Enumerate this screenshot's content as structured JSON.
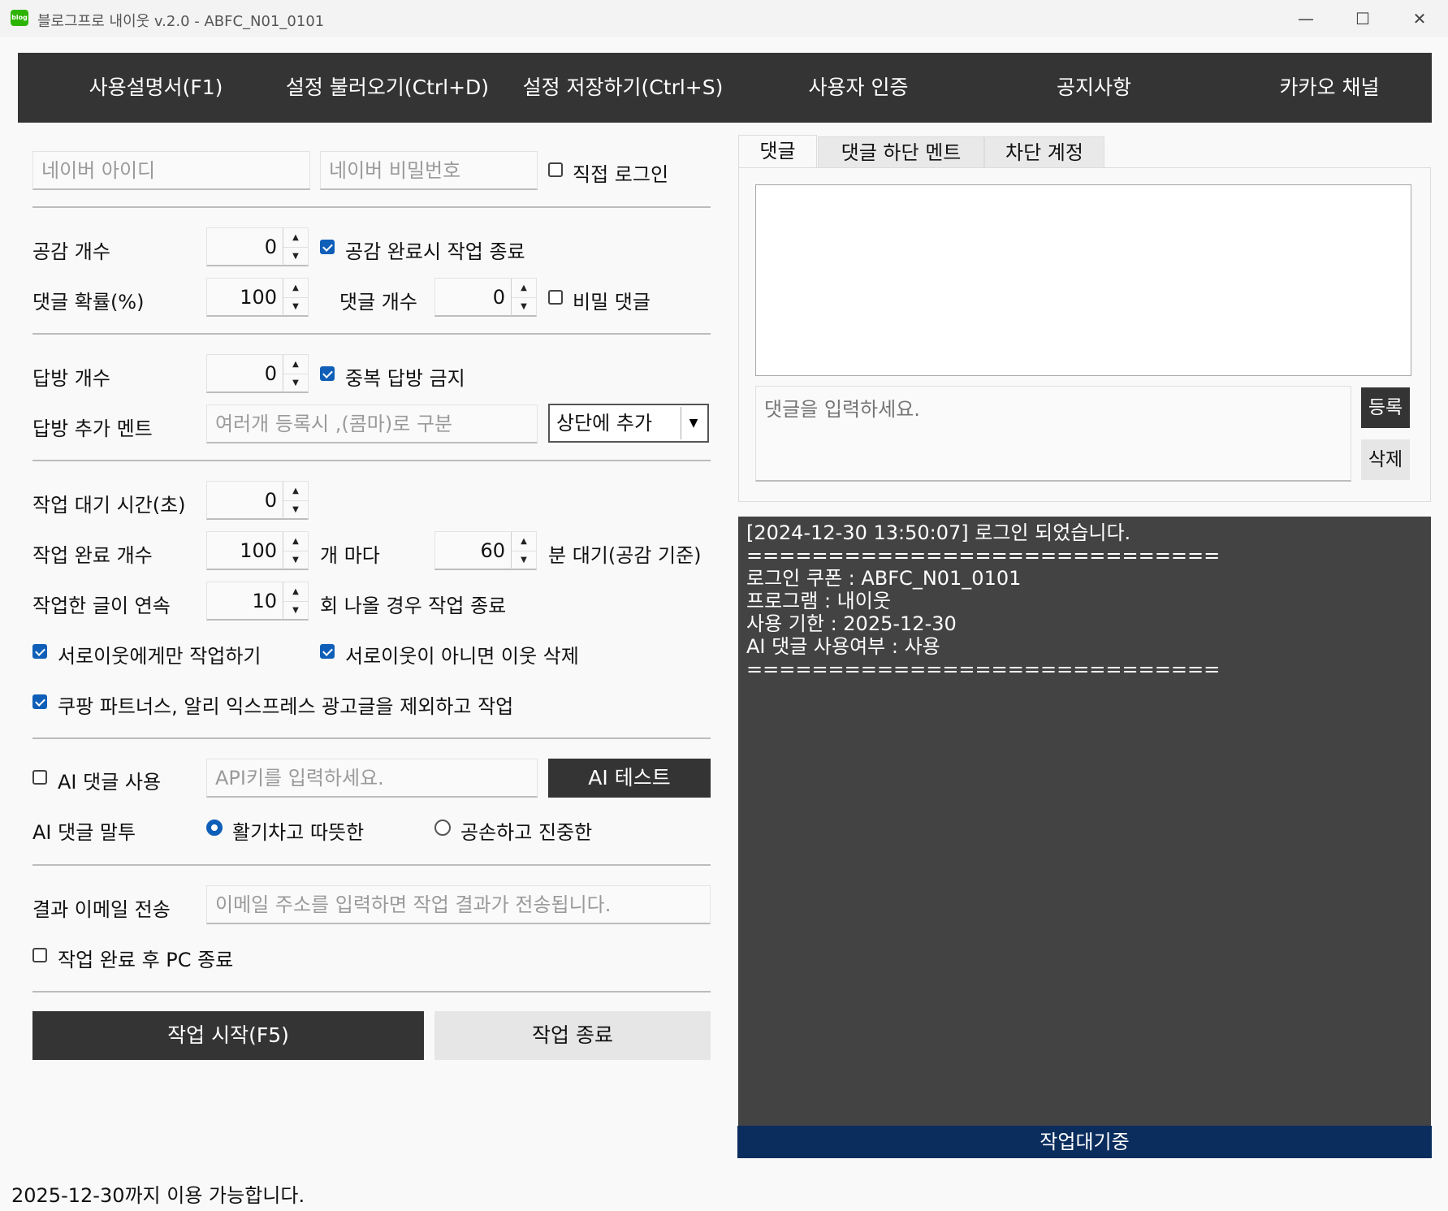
{
  "window": {
    "title": "블로그프로 내이웃 v.2.0 - ABFC_N01_0101",
    "app_icon_text": "blog",
    "minimize": "—",
    "maximize": "☐",
    "close": "✕"
  },
  "menu": {
    "items": [
      "사용설명서(F1)",
      "설정 불러오기(Ctrl+D)",
      "설정 저장하기(Ctrl+S)",
      "사용자 인증",
      "공지사항",
      "카카오 채널"
    ]
  },
  "login": {
    "id_placeholder": "네이버 아이디",
    "pw_placeholder": "네이버 비밀번호",
    "direct_login_label": "직접 로그인",
    "direct_login_checked": false
  },
  "like": {
    "count_label": "공감 개수",
    "count_value": "0",
    "stop_on_complete_label": "공감 완료시 작업 종료",
    "stop_on_complete_checked": true
  },
  "comment": {
    "prob_label": "댓글 확률(%)",
    "prob_value": "100",
    "count_label": "댓글 개수",
    "count_value": "0",
    "secret_label": "비밀 댓글",
    "secret_checked": false
  },
  "visit": {
    "count_label": "답방 개수",
    "count_value": "0",
    "no_dup_label": "중복 답방 금지",
    "no_dup_checked": true,
    "extra_label": "답방 추가 멘트",
    "extra_placeholder": "여러개 등록시 ,(콤마)로 구분",
    "position_value": "상단에 추가"
  },
  "work": {
    "wait_label": "작업 대기 시간(초)",
    "wait_value": "0",
    "done_count_label": "작업 완료 개수",
    "done_count_value": "100",
    "every_label": "개 마다",
    "minutes_value": "60",
    "minutes_label": "분 대기(공감 기준)",
    "repeat_label": "작업한 글이 연속",
    "repeat_value": "10",
    "repeat_suffix": "회 나올 경우 작업 종료",
    "neighbor_only_label": "서로이웃에게만 작업하기",
    "neighbor_only_checked": true,
    "delete_non_label": "서로이웃이 아니면 이웃 삭제",
    "delete_non_checked": true,
    "exclude_ads_label": "쿠팡 파트너스, 알리 익스프레스 광고글을 제외하고 작업",
    "exclude_ads_checked": true
  },
  "ai": {
    "use_label": "AI 댓글 사용",
    "use_checked": false,
    "api_placeholder": "API키를 입력하세요.",
    "test_button": "AI 테스트",
    "tone_label": "AI 댓글 말투",
    "tone_option1": "활기차고 따뜻한",
    "tone_option2": "공손하고 진중한",
    "tone_selected": 1
  },
  "email": {
    "label": "결과 이메일 전송",
    "placeholder": "이메일 주소를 입력하면 작업 결과가 전송됩니다."
  },
  "shutdown": {
    "label": "작업 완료 후 PC 종료",
    "checked": false
  },
  "actions": {
    "start": "작업 시작(F5)",
    "stop": "작업 종료"
  },
  "tabs": [
    "댓글",
    "댓글 하단 멘트",
    "차단 계정"
  ],
  "comment_panel": {
    "input_placeholder": "댓글을 입력하세요.",
    "register": "등록",
    "delete": "삭제"
  },
  "log": {
    "lines": [
      "[2024-12-30 13:50:07] 로그인 되었습니다.",
      "=============================",
      "로그인 쿠폰 : ABFC_N01_0101",
      "프로그램 : 내이웃",
      "사용 기한 : 2025-12-30",
      "AI 댓글 사용여부 : 사용",
      "============================="
    ]
  },
  "status": {
    "text": "작업대기중",
    "color": "#0a2d5e"
  },
  "footer": {
    "text": "2025-12-30까지 이용 가능합니다."
  }
}
